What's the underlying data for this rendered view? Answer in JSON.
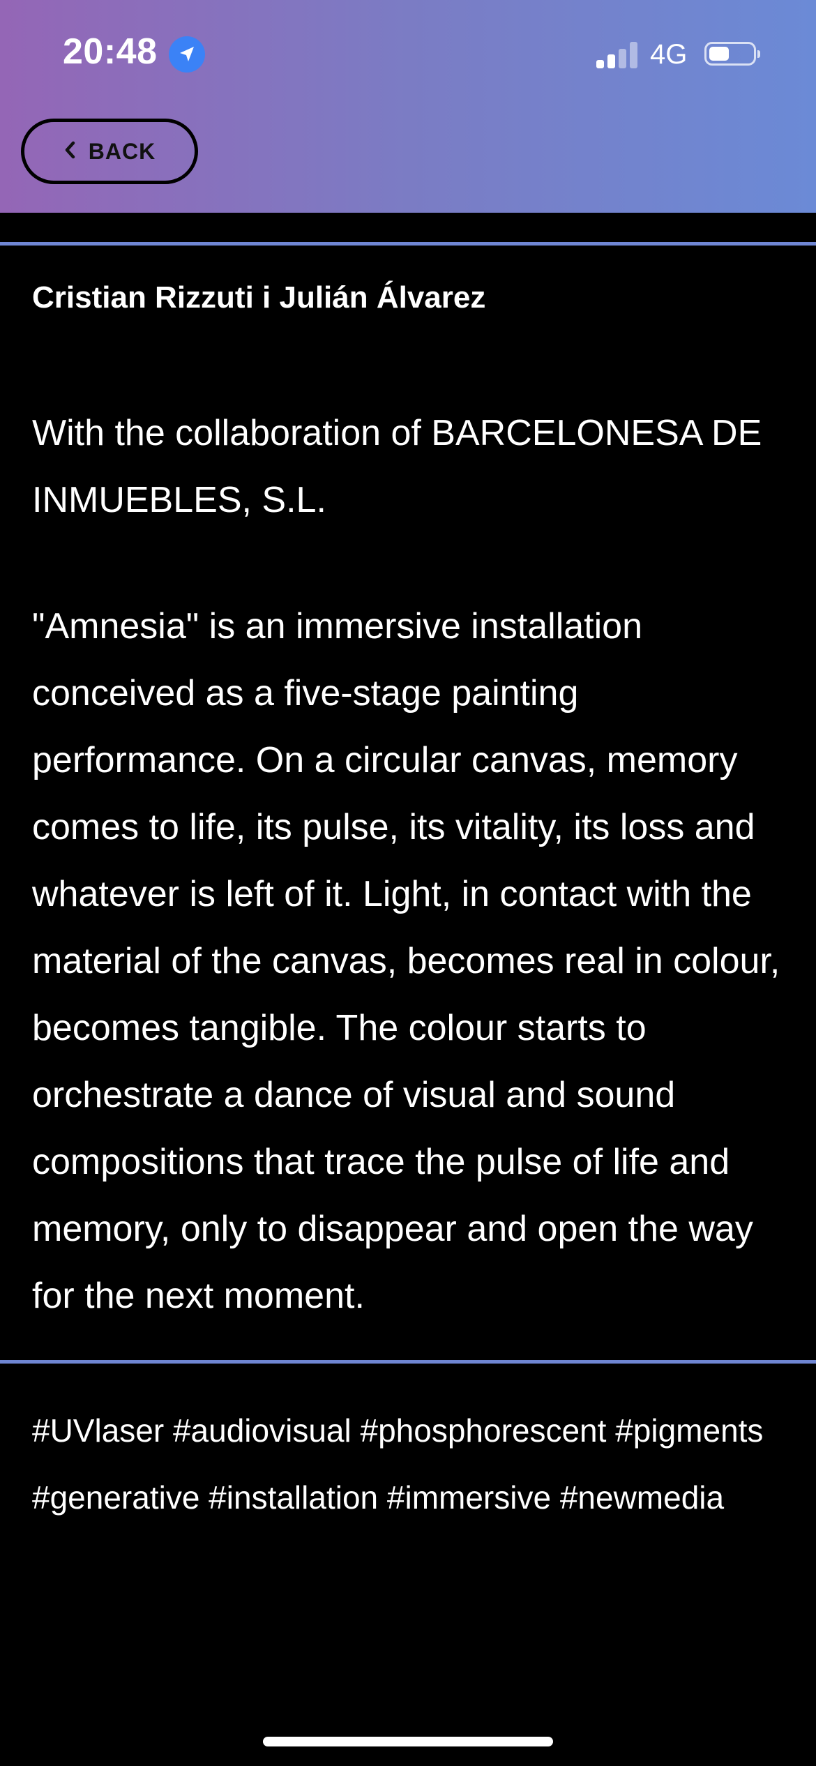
{
  "status_bar": {
    "time": "20:48",
    "network": "4G",
    "icons": [
      "location-arrow-icon",
      "cellular-signal-icon",
      "battery-icon"
    ]
  },
  "header": {
    "back_label": "BACK",
    "back_icon": "chevron-left-icon",
    "gradient_colors": [
      "#9466b6",
      "#6b8ad6"
    ]
  },
  "content": {
    "authors": "Cristian Rizzuti i Julián Álvarez",
    "collaboration": "With the collaboration of BARCELONESA DE INMUEBLES, S.L.",
    "description": "\"Amnesia\" is an immersive installation conceived as a five-stage painting performance.  On a circular canvas, memory comes to life, its pulse, its vitality, its loss and whatever is left of it. Light, in contact with the material of the canvas, becomes real in colour, becomes tangible. The colour starts to orchestrate a dance of visual and sound compositions that trace the pulse of life and memory, only to disappear and open the way for the next moment.",
    "tags": "#UVlaser #audiovisual #phosphorescent #pigments #generative #installation #immersive #newmedia"
  },
  "colors": {
    "background": "#000000",
    "divider": "#6f86d3",
    "text": "#ffffff"
  }
}
